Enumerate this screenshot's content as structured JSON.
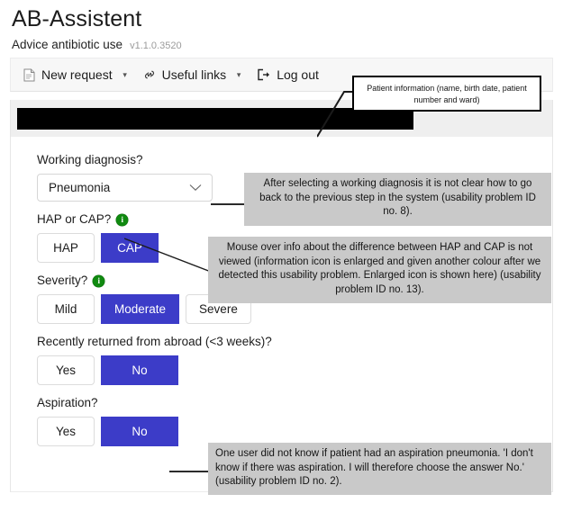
{
  "header": {
    "title": "AB-Assistent",
    "subtitle": "Advice antibiotic use",
    "version": "v1.1.0.3520"
  },
  "toolbar": {
    "new_request": "New request",
    "useful_links": "Useful links",
    "log_out": "Log out",
    "caret": "▾"
  },
  "patient_bar": {
    "redacted": ""
  },
  "form": {
    "working_diagnosis": {
      "label": "Working diagnosis?",
      "value": "Pneumonia"
    },
    "hap_or_cap": {
      "label": "HAP or CAP?",
      "options": [
        {
          "label": "HAP",
          "selected": false
        },
        {
          "label": "CAP",
          "selected": true
        }
      ]
    },
    "severity": {
      "label": "Severity?",
      "options": [
        {
          "label": "Mild",
          "selected": false
        },
        {
          "label": "Moderate",
          "selected": true
        },
        {
          "label": "Severe",
          "selected": false
        }
      ]
    },
    "returned_abroad": {
      "label": "Recently returned from abroad (<3 weeks)?",
      "options": [
        {
          "label": "Yes",
          "selected": false
        },
        {
          "label": "No",
          "selected": true
        }
      ]
    },
    "aspiration": {
      "label": "Aspiration?",
      "options": [
        {
          "label": "Yes",
          "selected": false
        },
        {
          "label": "No",
          "selected": true
        }
      ]
    }
  },
  "annotations": {
    "patient_info": "Patient information (name, birth date, patient number and ward)",
    "working_diagnosis": "After selecting a working diagnosis it is not clear how to go back to the previous step in the system (usability problem ID no. 8).",
    "hap_cap": "Mouse over info about the difference between HAP and CAP is not viewed (information icon is enlarged and given another colour after we detected this usability problem. Enlarged icon is shown here) (usability problem ID no. 13).",
    "aspiration": "One user did not know if patient had an aspiration pneumonia. 'I don't know if there was aspiration. I will therefore choose the answer No.' (usability problem ID no. 2)."
  },
  "colors": {
    "accent_blue": "#3c3cc8",
    "info_green": "#108a10",
    "callout_grey": "#c9c9c9",
    "redaction_black": "#000000"
  }
}
